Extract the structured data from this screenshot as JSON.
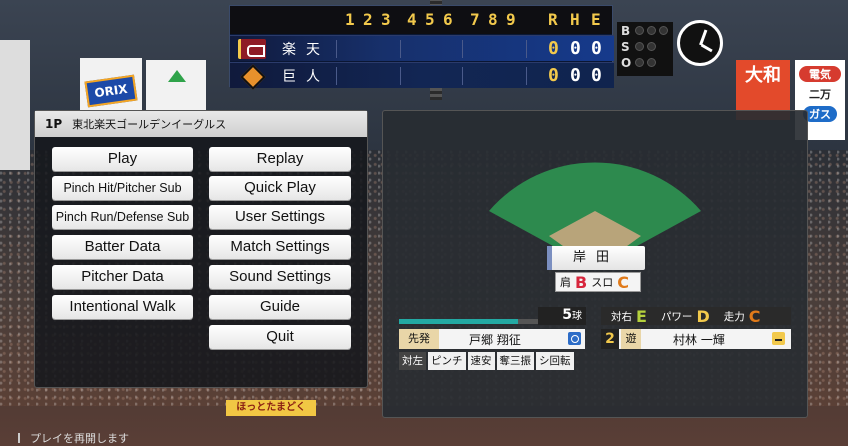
{
  "scoreboard": {
    "innings_header": [
      "1",
      "2",
      "3",
      "4",
      "5",
      "6",
      "7",
      "8",
      "9"
    ],
    "rhe_header": [
      "R",
      "H",
      "E"
    ],
    "teams": [
      {
        "name": "楽天",
        "runs": "0",
        "hits": "0",
        "errors": "0"
      },
      {
        "name": "巨人",
        "runs": "0",
        "hits": "0",
        "errors": "0"
      }
    ],
    "count_labels": [
      "B",
      "S",
      "O"
    ],
    "accent_color": "#f2c94c"
  },
  "menu": {
    "player": "1P",
    "team": "東北楽天ゴールデンイーグルス",
    "left": [
      "Play",
      "Pinch Hit/Pitcher Sub",
      "Pinch Run/Defense Sub",
      "Batter Data",
      "Pitcher Data",
      "Intentional Walk"
    ],
    "right": [
      "Replay",
      "Quick Play",
      "User Settings",
      "Match Settings",
      "Sound Settings",
      "Guide",
      "Quit"
    ]
  },
  "field": {
    "fielder_name": "岸田",
    "fielder_rating_label1": "肩",
    "fielder_rating_grade1": "B",
    "fielder_rating_label2": "スロ",
    "fielder_rating_grade2": "C"
  },
  "pitcher": {
    "pitch_count": "5",
    "pitch_unit": "球",
    "stamina_fraction": 0.85,
    "role": "先発",
    "name": "戸郷 翔征",
    "tags": [
      "対左",
      "ピンチ",
      "速安",
      "奪三振",
      "シ回転"
    ]
  },
  "batter": {
    "vs_label": "対右",
    "vs_grade": "E",
    "power_label": "パワー",
    "power_grade": "D",
    "run_label": "走力",
    "run_grade": "C",
    "order": "2",
    "position": "遊",
    "name": "村林 一輝"
  },
  "ads": {
    "orix": "ORIX",
    "daiwa": "大和",
    "kansai_top": "電気",
    "kansai_mid": "二万",
    "kansai_gas": "ガス",
    "bottom_banner": "ほっとたまどく"
  },
  "hint": "プレイを再開します"
}
